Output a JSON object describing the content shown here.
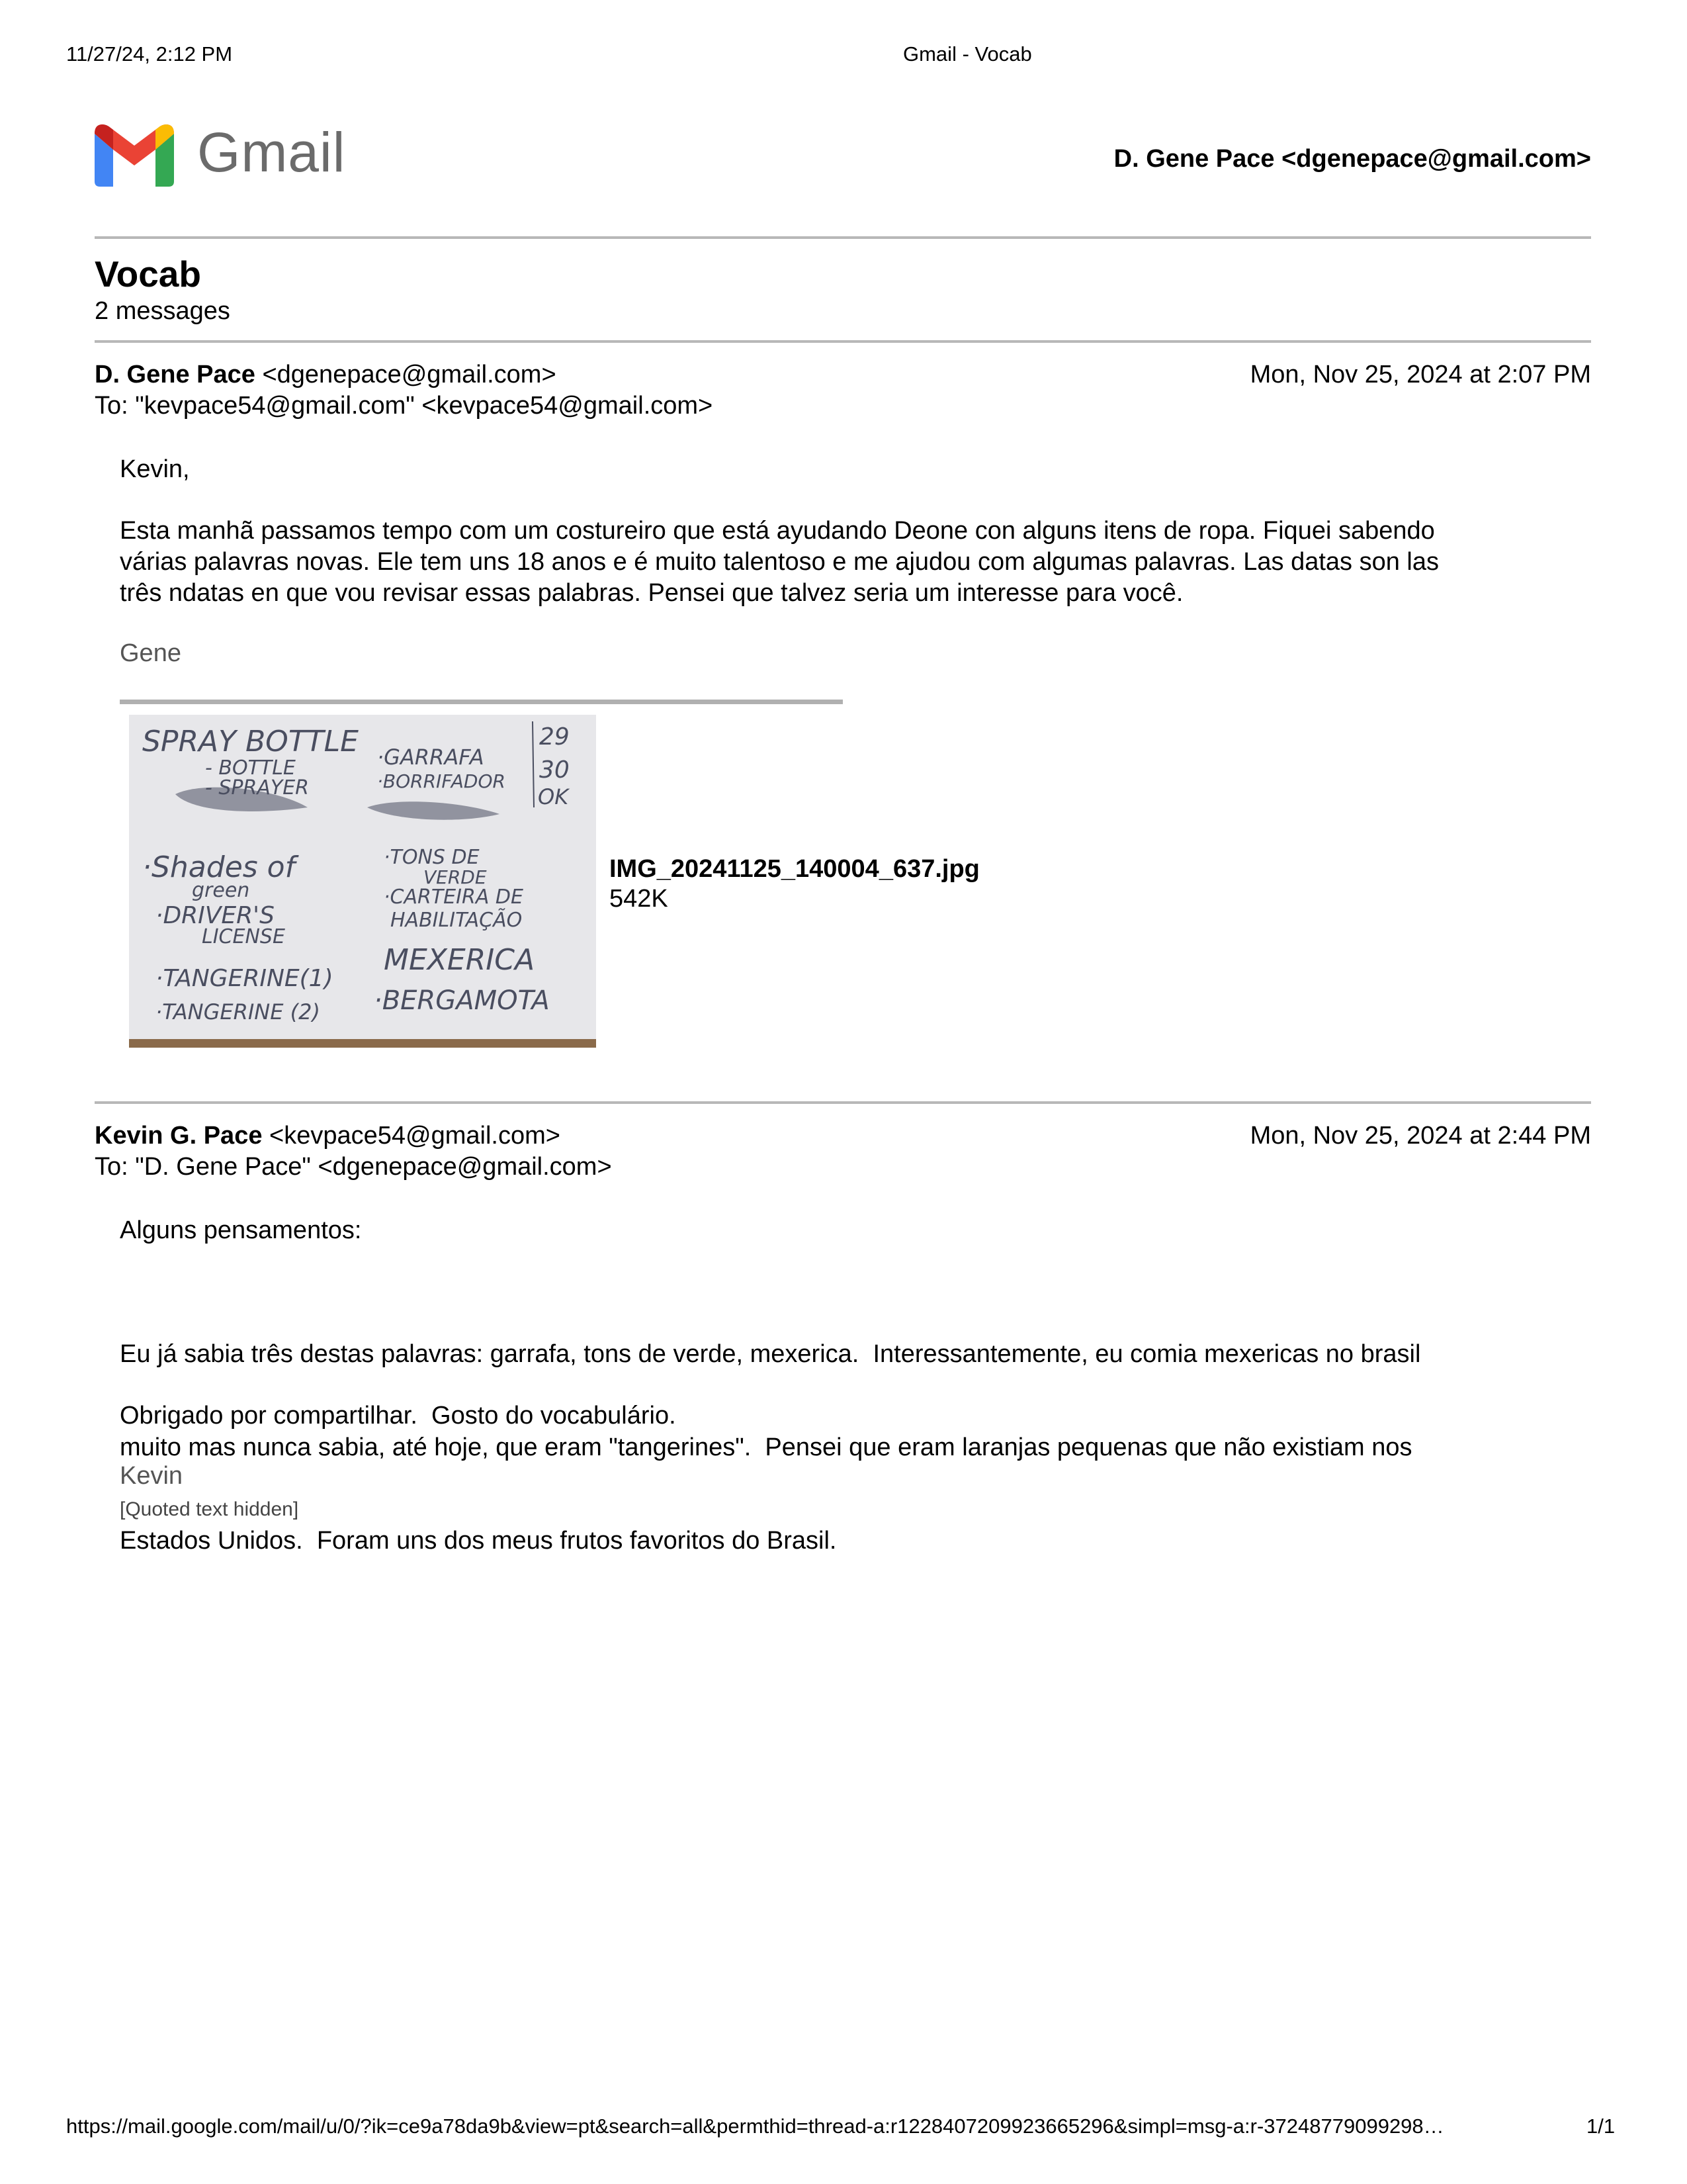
{
  "print_header": {
    "datetime": "11/27/24, 2:12 PM",
    "title": "Gmail - Vocab"
  },
  "logo": {
    "wordmark": "Gmail"
  },
  "account": "D. Gene Pace <dgenepace@gmail.com>",
  "thread": {
    "subject": "Vocab",
    "count": "2 messages"
  },
  "messages": [
    {
      "from_name": "D. Gene Pace",
      "from_email": "<dgenepace@gmail.com>",
      "date": "Mon, Nov 25, 2024 at 2:07 PM",
      "to": "To: \"kevpace54@gmail.com\" <kevpace54@gmail.com>",
      "greeting": "Kevin,",
      "paragraph_lines": [
        "Esta manhã passamos tempo com um costureiro que está ayudando Deone con alguns itens de ropa. Fiquei sabendo",
        "várias palavras novas. Ele tem uns 18 anos e é muito talentoso e me ajudou com algumas palavras. Las datas son las",
        "três ndatas en que vou revisar essas palabras. Pensei que talvez seria um interesse para você."
      ],
      "signature": "Gene",
      "attachment": {
        "filename": "IMG_20241125_140004_637.jpg",
        "size": "542K",
        "note_lines": [
          "SPRAY BOTTLE",
          "- BOTTLE",
          "- SPRAYER",
          "·GARRAFA",
          "·BORRIFADOR",
          "29",
          "30",
          "OK",
          "·Shades of",
          "green",
          "·DRIVER'S",
          "LICENSE",
          "·TONS DE",
          "VERDE",
          "·CARTEIRA DE",
          "HABILITAÇÃO",
          "·TANGERINE(1)",
          "·TANGERINE (2)",
          "MEXERICA",
          "·BERGAMOTA"
        ]
      }
    },
    {
      "from_name": "Kevin G. Pace",
      "from_email": "<kevpace54@gmail.com>",
      "date": "Mon, Nov 25, 2024 at 2:44 PM",
      "to": "To: \"D. Gene Pace\" <dgenepace@gmail.com>",
      "greeting": "Alguns pensamentos:",
      "paragraph_lines": [
        "Eu já sabia três destas palavras: garrafa, tons de verde, mexerica.  Interessantemente, eu comia mexericas no brasil",
        "muito mas nunca sabia, até hoje, que eram \"tangerines\".  Pensei que eram laranjas pequenas que não existiam nos",
        "Estados Unidos.  Foram uns dos meus frutos favoritos do Brasil."
      ],
      "paragraph2": "Obrigado por compartilhar.  Gosto do vocabulário.",
      "signature": "Kevin",
      "quoted": "[Quoted text hidden]"
    }
  ],
  "footer": {
    "url": "https://mail.google.com/mail/u/0/?ik=ce9a78da9b&view=pt&search=all&permthid=thread-a:r1228407209923665296&simpl=msg-a:r-37248779099298…",
    "page": "1/1"
  }
}
